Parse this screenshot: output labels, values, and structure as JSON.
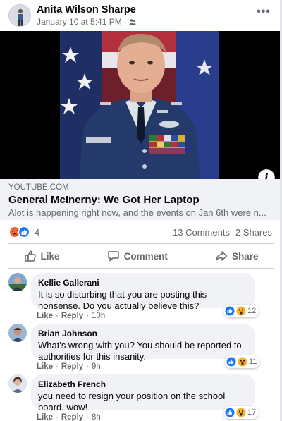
{
  "post": {
    "author": "Anita Wilson Sharpe",
    "timestamp": "January 10 at 5:41 PM",
    "separator": "·",
    "privacy_icon": "friends-icon",
    "more_label": "•••"
  },
  "link": {
    "domain": "YOUTUBE.COM",
    "title": "General McInerny: We Got Her Laptop",
    "description": "Alot is happening right now, and the events on Jan 6th were n...",
    "info_label": "i"
  },
  "stats": {
    "reactions": [
      "angry",
      "like"
    ],
    "reaction_count": "4",
    "comments": "13 Comments",
    "shares": "2 Shares"
  },
  "actions": {
    "like": "Like",
    "comment": "Comment",
    "share": "Share"
  },
  "comments": [
    {
      "name": "Kellie Gallerani",
      "text": "It is so disturbing that you are posting this nonsense. Do you actually believe this?",
      "like": "Like",
      "reply": "Reply",
      "time": "10h",
      "reactions": [
        "like",
        "wow"
      ],
      "reaction_count": "12"
    },
    {
      "name": "Brian Johnson",
      "text": "What's wrong with you? You should be reported to authorities for this insanity.",
      "like": "Like",
      "reply": "Reply",
      "time": "9h",
      "reactions": [
        "like",
        "wow"
      ],
      "reaction_count": "11"
    },
    {
      "name": "Elizabeth French",
      "text": "you need to resign your position on the school board. wow!",
      "like": "Like",
      "reply": "Reply",
      "time": "8h",
      "reactions": [
        "like",
        "wow"
      ],
      "reaction_count": "17"
    }
  ],
  "colors": {
    "like_blue": "#1877f2",
    "angry_orange": "#f0653b",
    "wow_yellow": "#f7b125",
    "secondary_text": "#65676b",
    "bubble_bg": "#f0f2f5"
  }
}
